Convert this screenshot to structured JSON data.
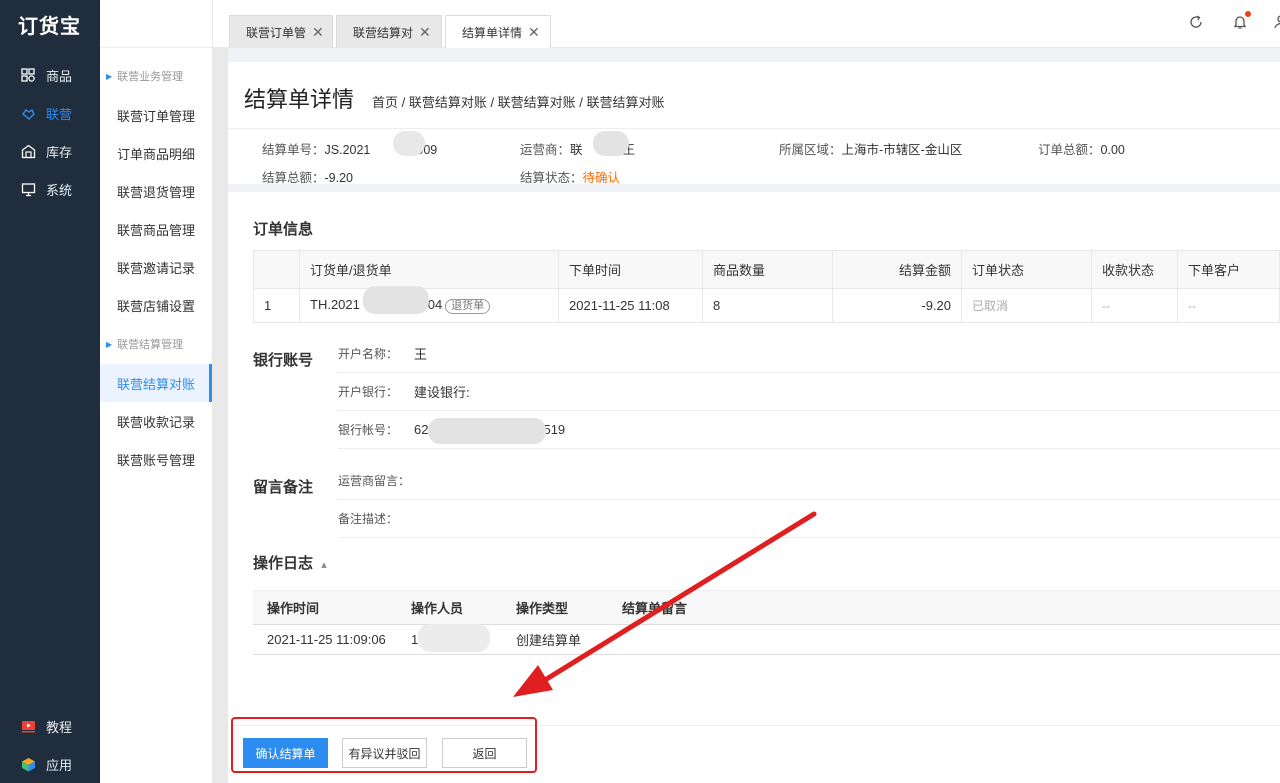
{
  "app": {
    "logo": "订货宝"
  },
  "leftnav": {
    "items": [
      {
        "label": "商品",
        "icon": "grid-icon"
      },
      {
        "label": "联营",
        "icon": "handshake-icon",
        "active": true
      },
      {
        "label": "库存",
        "icon": "warehouse-icon"
      },
      {
        "label": "系统",
        "icon": "monitor-icon"
      }
    ],
    "bottom": [
      {
        "label": "教程",
        "icon": "video-icon"
      },
      {
        "label": "应用",
        "icon": "cube-icon"
      }
    ]
  },
  "subnav": {
    "group1": "联营业务管理",
    "group1_items": [
      "联营订单管理",
      "订单商品明细",
      "联营退货管理",
      "联营商品管理",
      "联营邀请记录",
      "联营店铺设置"
    ],
    "group2": "联营结算管理",
    "group2_items": [
      "联营结算对账",
      "联营收款记录",
      "联营账号管理"
    ],
    "active": "联营结算对账"
  },
  "tabs": [
    {
      "label": "联营订单管",
      "close": "✕"
    },
    {
      "label": "联营结算对",
      "close": "✕"
    },
    {
      "label": "结算单详情",
      "close": "✕",
      "active": true
    }
  ],
  "topbar": {
    "refresh_icon": "refresh-icon",
    "bell_icon": "bell-icon",
    "user_icon": "user-icon"
  },
  "page": {
    "title": "结算单详情",
    "breadcrumb": "首页 / 联营结算对账 / 联营结算对账 / 联营结算对账"
  },
  "summary": {
    "settle_no_label": "结算单号：",
    "settle_no_a": "JS.2021",
    "settle_no_b": "009",
    "operator_label": "运营商：",
    "operator_a": "联",
    "operator_b": "王",
    "region_label": "所属区域：",
    "region": "上海市-市辖区-金山区",
    "order_total_label": "订单总额：",
    "order_total": "0.00",
    "settle_total_label": "结算总额：",
    "settle_total": "-9.20",
    "status_label": "结算状态：",
    "status": "待确认"
  },
  "order_info": {
    "title": "订单信息",
    "columns": [
      "",
      "订货单/退货单",
      "下单时间",
      "商品数量",
      "结算金额",
      "订单状态",
      "收款状态",
      "下单客户"
    ],
    "rows": [
      {
        "idx": "1",
        "no_a": "TH.2021",
        "no_b": "7.04",
        "tag": "退货单",
        "time": "2021-11-25 11:08",
        "qty": "8",
        "amount": "-9.20",
        "order_status": "已取消",
        "pay_status": "--",
        "customer": "--"
      }
    ]
  },
  "bank": {
    "title": "银行账号",
    "name_label": "开户名称：",
    "name_value": "王",
    "bank_label": "开户银行：",
    "bank_value": "建设银行:",
    "account_label": "银行帐号：",
    "account_a": "62",
    "account_b": "519"
  },
  "remarks": {
    "title": "留言备注",
    "operator_msg_label": "运营商留言：",
    "note_label": "备注描述："
  },
  "log": {
    "title": "操作日志",
    "toggle": "▴",
    "columns": [
      "操作时间",
      "操作人员",
      "操作类型",
      "结算单留言"
    ],
    "rows": [
      {
        "time": "2021-11-25 11:09:06",
        "user_a": "1",
        "user_b": "5",
        "type": "创建结算单",
        "msg": ""
      }
    ]
  },
  "actions": {
    "confirm": "确认结算单",
    "reject": "有异议并驳回",
    "back": "返回"
  },
  "colors": {
    "primary": "#2d8cf0",
    "warning": "#ff6a00",
    "nav_bg": "#1f2d3d",
    "annotation": "#e02020"
  }
}
